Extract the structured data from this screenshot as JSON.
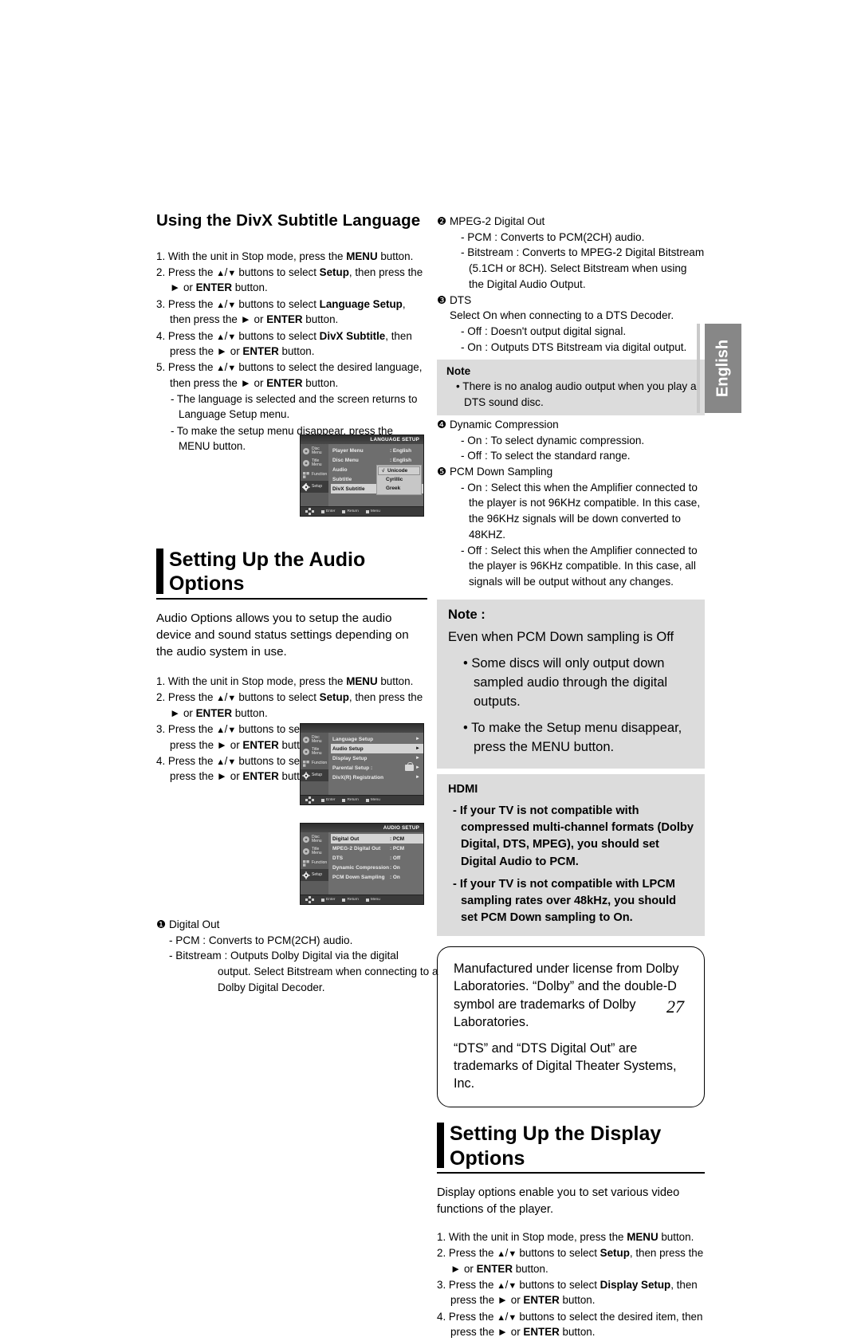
{
  "page_number": "27",
  "side_tab": "English",
  "left_column": {
    "subtitle_section": {
      "heading": "Using the DivX Subtitle Language",
      "steps": [
        "1. With the unit in Stop mode, press the <b>MENU</b> button.",
        "2. Press the <span class='ar'>▲</span>/<span class='ar'>▼</span> buttons to select <b>Setup</b>, then press the ► or <b>ENTER</b> button.",
        "3. Press the <span class='ar'>▲</span>/<span class='ar'>▼</span> buttons to select <b>Language Setup</b>, then press the ► or <b>ENTER</b> button.",
        "4. Press the <span class='ar'>▲</span>/<span class='ar'>▼</span> buttons to select <b>DivX Subtitle</b>, then press the ► or <b>ENTER</b> button.",
        "5. Press the <span class='ar'>▲</span>/<span class='ar'>▼</span> buttons to select the desired  language, then press the ► or <b>ENTER</b> button."
      ],
      "sub_notes": [
        "- The language is selected and the screen returns to Language Setup menu.",
        "- To make the setup menu disappear, press the MENU button."
      ]
    },
    "audio_section": {
      "heading": "Setting Up the Audio Options",
      "intro": "Audio Options allows you to setup the audio device and sound status settings depending on the audio system in use.",
      "steps": [
        "1. With the unit in Stop mode, press the <b>MENU</b> button.",
        "2. Press the <span class='ar'>▲</span>/<span class='ar'>▼</span> buttons to select <b>Setup</b>, then press the ► or <b>ENTER</b> button.",
        "3. Press the <span class='ar'>▲</span>/<span class='ar'>▼</span> buttons to select <b>Audio Setup</b>, then press the ► or <b>ENTER</b> button.",
        "4. Press the <span class='ar'>▲</span>/<span class='ar'>▼</span> buttons to select the desired item, then press the ► or <b>ENTER</b> button."
      ]
    },
    "digital_out": {
      "title": "❶ Digital Out",
      "pcm": "- PCM : Converts to PCM(2CH) audio.",
      "bitstream": "- Bitstream : Outputs Dolby Digital via the digital",
      "bitstream_cont": "output. Select Bitstream when connecting to a Dolby Digital Decoder."
    }
  },
  "right_column": {
    "mpeg2": {
      "title": "❷ MPEG-2 Digital Out",
      "pcm": "- PCM : Converts to PCM(2CH) audio.",
      "bitstream": "- Bitstream : Converts to MPEG-2 Digital Bitstream",
      "bitstream_cont": "(5.1CH or 8CH). Select Bitstream when using the Digital Audio Output."
    },
    "dts": {
      "title": "❸ DTS",
      "lead": "Select On when connecting to a DTS Decoder.",
      "off": "- Off : Doesn't output digital signal.",
      "on": "- On : Outputs DTS Bitstream via digital output."
    },
    "note1": {
      "title": "Note",
      "bullet": "• There is no analog audio output when you play a DTS sound disc."
    },
    "dynamic_compression": {
      "title": "❹ Dynamic Compression",
      "on": "- On : To select dynamic compression.",
      "off": "- Off : To select the standard range."
    },
    "pcm_down_sampling": {
      "title": "❺ PCM Down Sampling",
      "on": "- On : Select this when the Amplifier connected to the player is not 96KHz compatible. In this case, the 96KHz signals will be down converted to 48KHZ.",
      "off": "- Off : Select this when the Amplifier connected to the player is 96KHz compatible. In this case, all signals will be output without any changes."
    },
    "note2": {
      "title": "Note :",
      "subtitle": "Even when PCM Down sampling is Off",
      "bullets": [
        "• Some discs will only output down sampled audio through the digital outputs.",
        "• To make the Setup menu disappear, press the MENU button."
      ]
    },
    "hdmi": {
      "title": "HDMI",
      "items": [
        "- If your TV is not compatible with compressed multi-channel formats (Dolby Digital, DTS, MPEG), you should set Digital Audio to PCM.",
        "- If your TV is not compatible with LPCM sampling rates over 48kHz, you should set PCM Down sampling to On."
      ]
    },
    "trademarks": {
      "dolby": "Manufactured under license from Dolby Laboratories. “Dolby” and the double-D symbol are trademarks of Dolby Laboratories.",
      "dts": "“DTS” and “DTS Digital Out” are trademarks of Digital Theater Systems, Inc."
    },
    "display_section": {
      "heading": "Setting Up the Display Options",
      "intro": "Display options enable you to set various video functions of the player.",
      "steps": [
        "1. With the unit in Stop mode, press the <b>MENU</b> button.",
        "2. Press the <span class='ar'>▲</span>/<span class='ar'>▼</span> buttons to select <b>Setup</b>, then press the ► or <b>ENTER</b> button.",
        "3. Press the <span class='ar'>▲</span>/<span class='ar'>▼</span> buttons to select <b>Display Setup</b>, then press the ► or <b>ENTER</b> button.",
        "4. Press the <span class='ar'>▲</span>/<span class='ar'>▼</span> buttons to select the desired item, then press the ► or <b>ENTER</b> button."
      ]
    }
  },
  "osd_language_setup": {
    "title": "LANGUAGE SETUP",
    "sidebar": [
      "Disc Menu",
      "Title Menu",
      "Function",
      "Setup"
    ],
    "rows": [
      {
        "label": "Player Menu",
        "value": ": English"
      },
      {
        "label": "Disc Menu",
        "value": ": English"
      },
      {
        "label": "Audio",
        "value": ": English"
      },
      {
        "label": "Subtitle",
        "value": ""
      },
      {
        "label": "DivX Subtitle",
        "value": ""
      }
    ],
    "dropdown": [
      "Unicode",
      "Cyrillic",
      "Greek"
    ],
    "footer": [
      "Enter",
      "Return",
      "Menu"
    ]
  },
  "osd_setup_menu": {
    "title": "",
    "sidebar": [
      "Disc Menu",
      "Title Menu",
      "Function",
      "Setup"
    ],
    "rows": [
      {
        "label": "Language Setup",
        "value": "",
        "selected": false
      },
      {
        "label": "Audio Setup",
        "value": "",
        "selected": true
      },
      {
        "label": "Display Setup",
        "value": "",
        "selected": false
      },
      {
        "label": "Parental Setup :",
        "value": "",
        "selected": false
      },
      {
        "label": "DivX(R) Registration",
        "value": "",
        "selected": false
      }
    ],
    "footer": [
      "Enter",
      "Return",
      "Menu"
    ]
  },
  "osd_audio_setup": {
    "title": "AUDIO SETUP",
    "sidebar": [
      "Disc Menu",
      "Title Menu",
      "Function",
      "Setup"
    ],
    "rows": [
      {
        "label": "Digital Out",
        "value": ": PCM",
        "selected": true
      },
      {
        "label": "MPEG-2 Digital Out",
        "value": ":  PCM",
        "selected": false
      },
      {
        "label": "DTS",
        "value": ": Off",
        "selected": false
      },
      {
        "label": "Dynamic Compression",
        "value": ": On",
        "selected": false
      },
      {
        "label": "PCM Down Sampling",
        "value": ": On",
        "selected": false
      }
    ],
    "footer": [
      "Enter",
      "Return",
      "Menu"
    ]
  }
}
